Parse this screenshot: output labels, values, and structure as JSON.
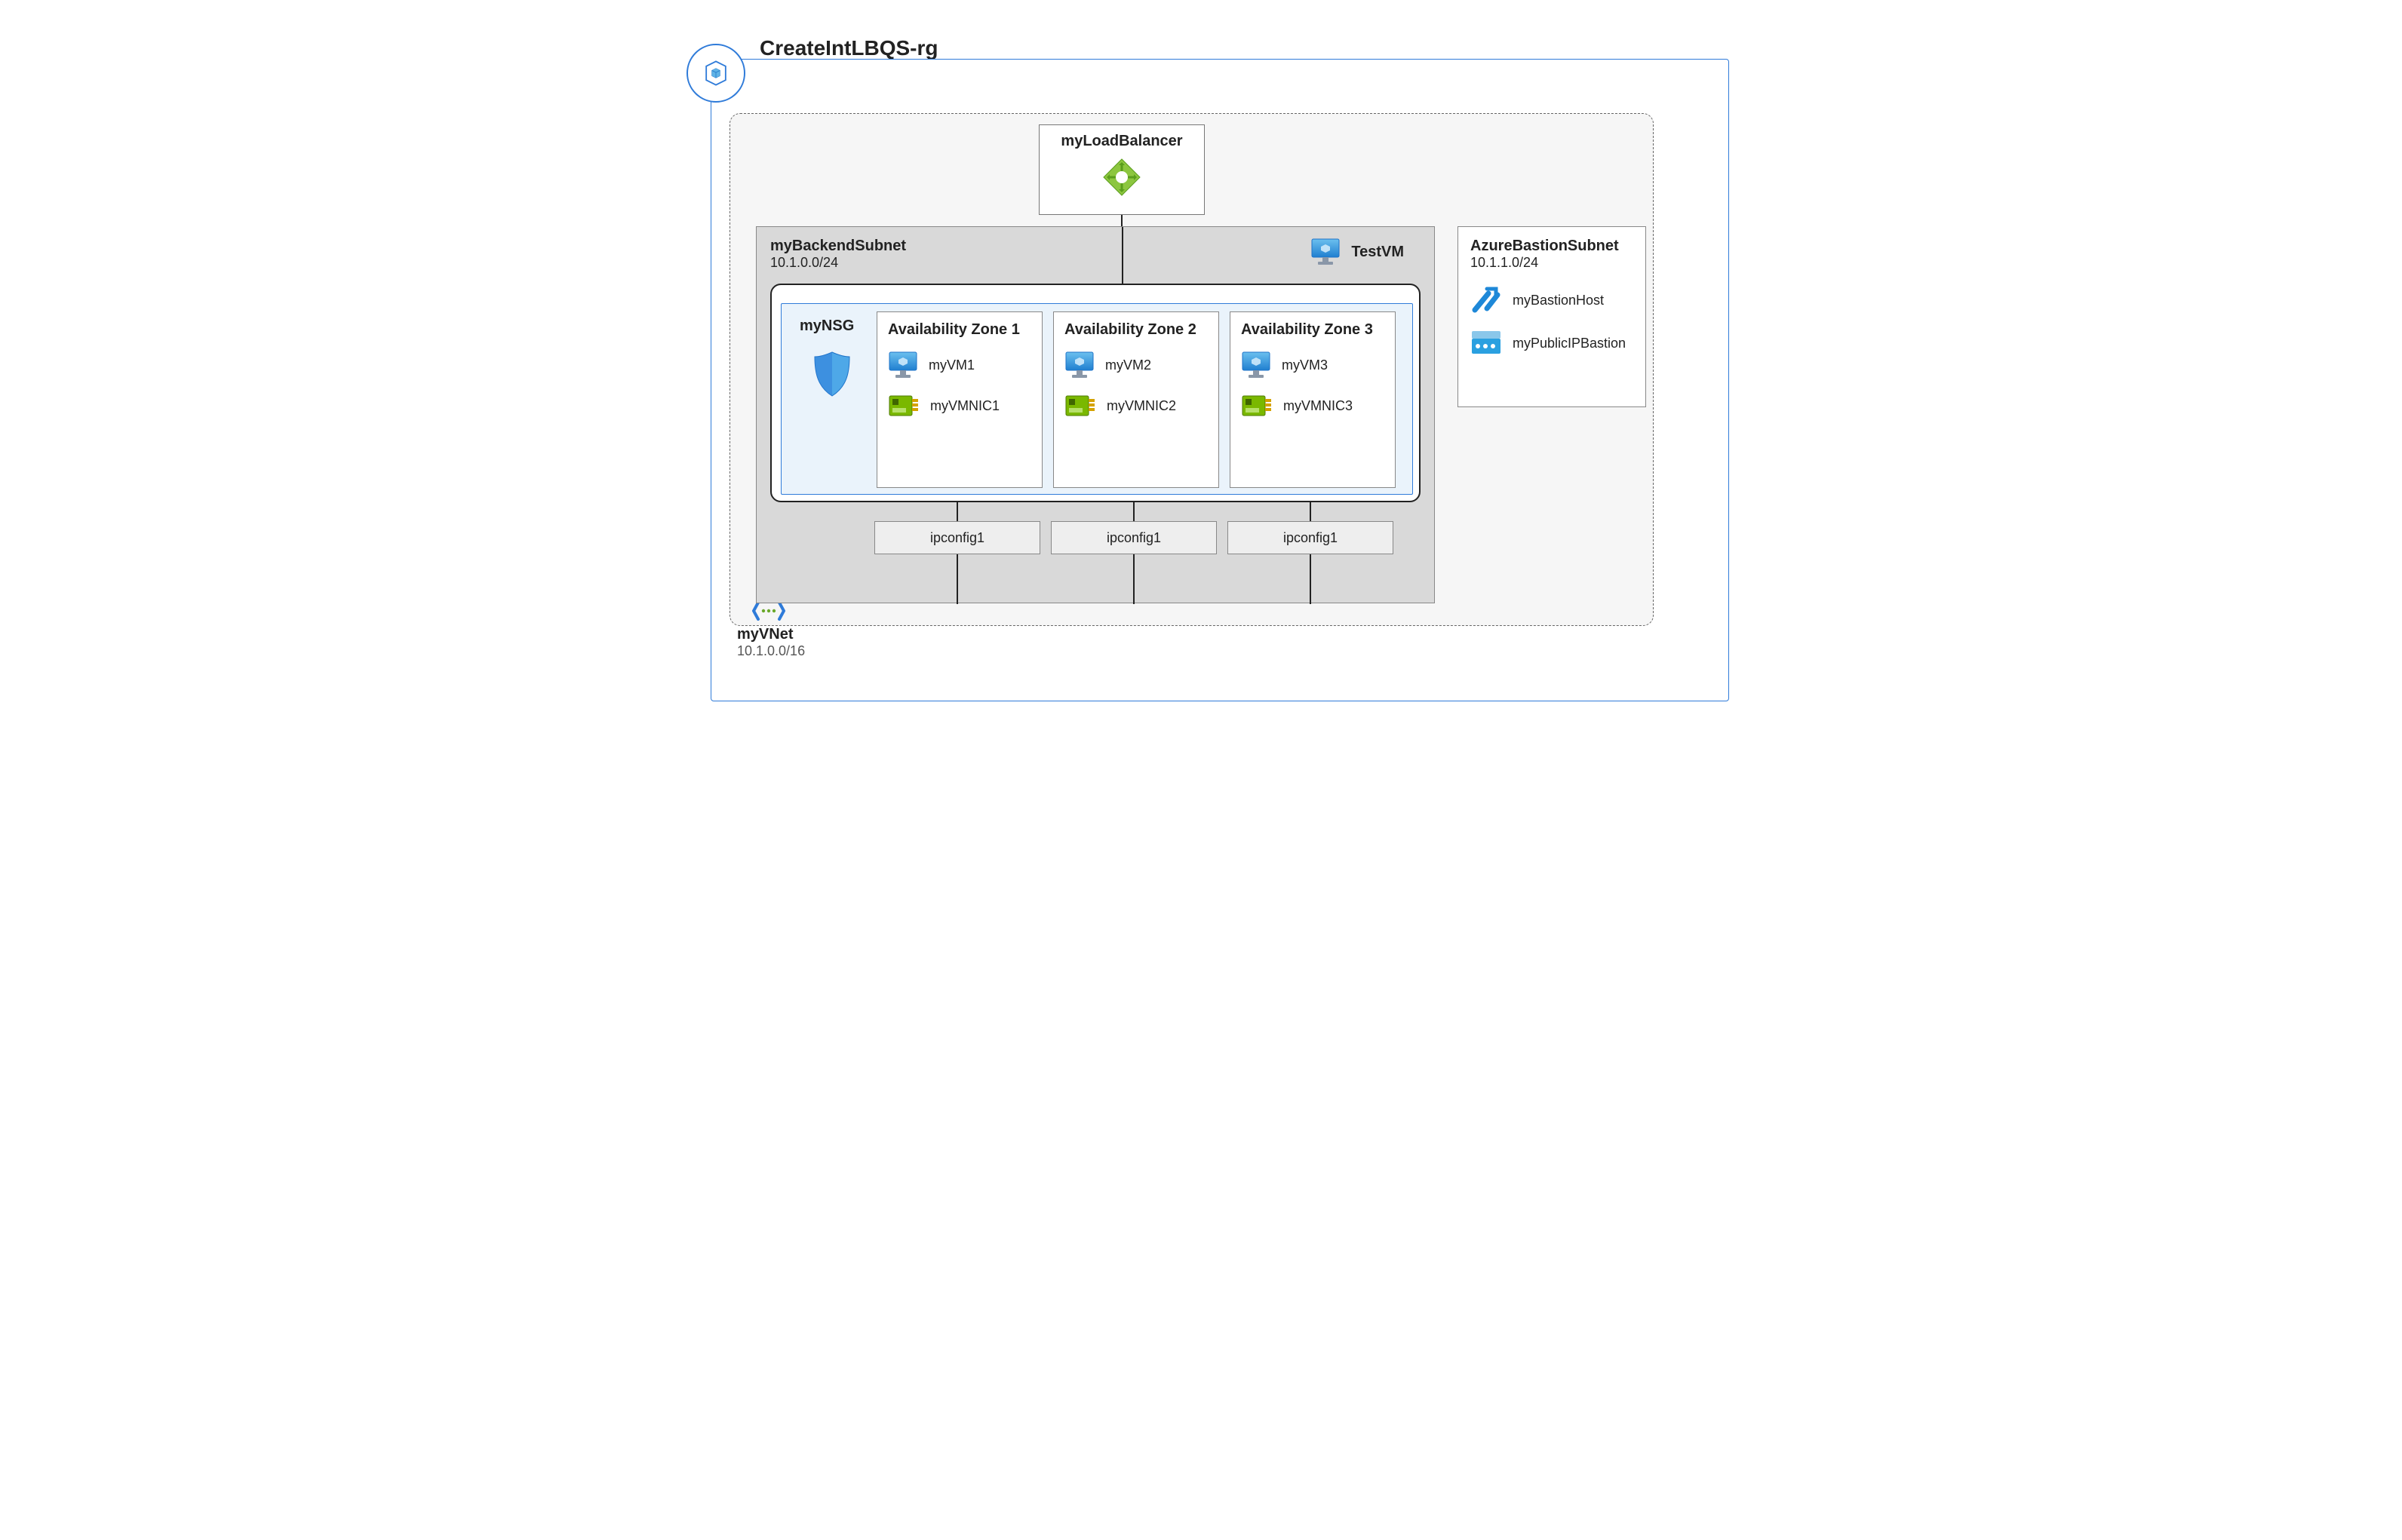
{
  "resourceGroup": {
    "name": "CreateIntLBQS-rg"
  },
  "vnet": {
    "name": "myVNet",
    "cidr": "10.1.0.0/16"
  },
  "loadBalancer": {
    "name": "myLoadBalancer"
  },
  "backendSubnet": {
    "name": "myBackendSubnet",
    "cidr": "10.1.0.0/24"
  },
  "testVM": {
    "name": "TestVM"
  },
  "nsg": {
    "name": "myNSG"
  },
  "availabilityZones": [
    {
      "title": "Availability Zone 1",
      "vm": "myVM1",
      "nic": "myVMNIC1",
      "ipconfig": "ipconfig1"
    },
    {
      "title": "Availability Zone 2",
      "vm": "myVM2",
      "nic": "myVMNIC2",
      "ipconfig": "ipconfig1"
    },
    {
      "title": "Availability Zone 3",
      "vm": "myVM3",
      "nic": "myVMNIC3",
      "ipconfig": "ipconfig1"
    }
  ],
  "bastionSubnet": {
    "name": "AzureBastionSubnet",
    "cidr": "10.1.1.0/24",
    "host": "myBastionHost",
    "publicIp": "myPublicIPBastion"
  },
  "colors": {
    "azureBlue": "#2f7bd9",
    "cubeGradTop": "#5fb3e6",
    "cubeGradBottom": "#1e73c8",
    "nicGreen": "#7ab800",
    "bastionBlue": "#1e88d8",
    "ipBrowser": "#2aa0e0"
  }
}
